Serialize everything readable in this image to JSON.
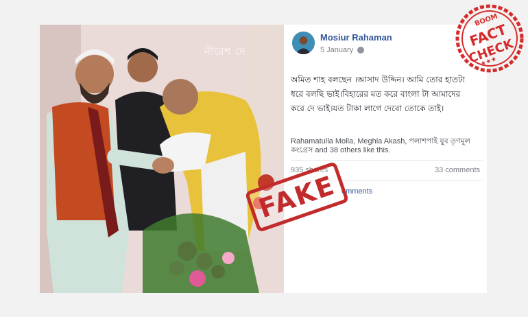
{
  "photo": {
    "watermark_text": "নীরেশ দে",
    "description_icon": "photo-image"
  },
  "post": {
    "author": "Mosiur Rahaman",
    "date": "5 January",
    "privacy_icon": "globe-icon",
    "text_lines": [
      "অমিত শাহ বলছেন ।আসাদ উদ্দিন। আমি তোর হাতটা",
      "ধরে বলছি ভাই।বিহারের মত করে বাংলা টা আমাদের",
      "করে দে ভাই।যত টাকা লাগে দেবো তোকে তাই।"
    ],
    "likes_text": "Rahamatulla Molla, Meghla Akash, পলাশপাই যুব তৃণমূল কংগ্রেস and 38 others like this.",
    "shares": "935 shares",
    "comments": "33 comments",
    "view_comments_partial": "omments"
  },
  "stamp": {
    "text": "FAKE",
    "color": "#c22b2b"
  },
  "logo": {
    "top_text": "BOOM",
    "line1": "FACT",
    "line2": "CHECK",
    "color": "#d62b2b"
  },
  "colors": {
    "background": "#f2f2f2",
    "link": "#365899",
    "muted": "#7b7f86"
  }
}
